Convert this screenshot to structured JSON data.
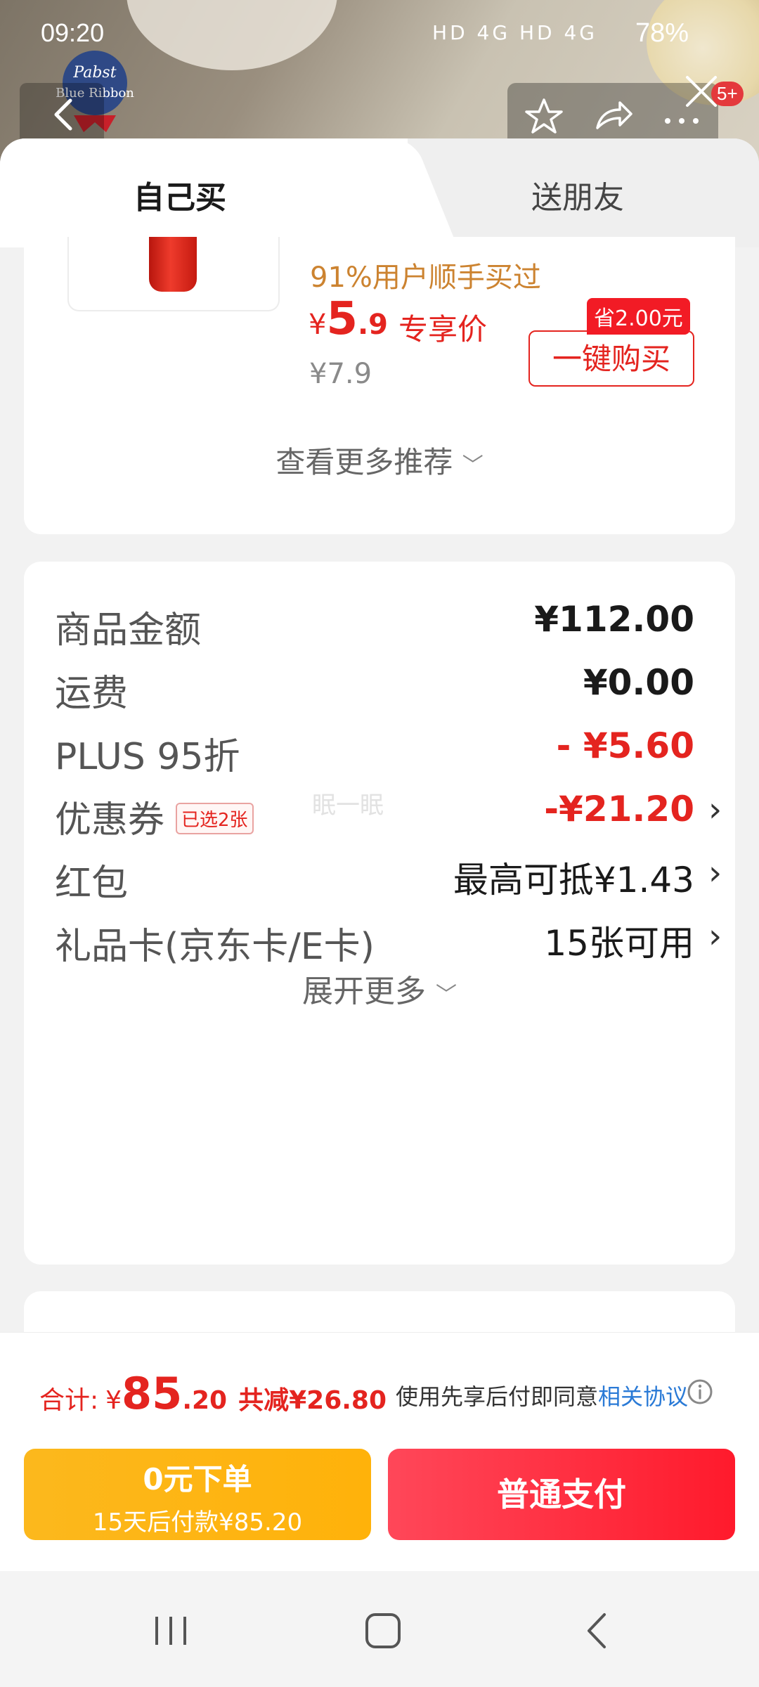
{
  "status_bar": {
    "time": "09:20",
    "battery": "78%",
    "signal": "HD 4G HD 4G"
  },
  "brand": {
    "logo_text": "Pabst Blue Ribbon"
  },
  "top_badge": "5+",
  "tabs": {
    "self": "自己买",
    "friend": "送朋友"
  },
  "recommend": {
    "hot_text": "91%用户顺手买过",
    "price_currency": "¥",
    "price_int": "5",
    "price_dec": ".9",
    "exclusive": "专享价",
    "old_price": "¥7.9",
    "save_tag": "省2.00元",
    "buy_button": "一键购买",
    "more": "查看更多推荐"
  },
  "summary": {
    "rows": [
      {
        "label": "商品金额",
        "value": "¥112.00"
      },
      {
        "label": "运费",
        "value": "¥0.00"
      },
      {
        "label": "PLUS 95折",
        "value": "- ¥5.60"
      },
      {
        "label": "优惠券",
        "tag": "已选2张",
        "value": "-¥21.20"
      },
      {
        "label": "红包",
        "value": "最高可抵¥1.43"
      },
      {
        "label": "礼品卡(京东卡/E卡)",
        "value": "15张可用"
      }
    ],
    "expand": "展开更多",
    "watermark": "眠一眠"
  },
  "bottom": {
    "total_label": "合计:",
    "total_currency": "¥",
    "total_int": "85",
    "total_dec": ".20",
    "total_less": "共减¥26.80",
    "agree_text": "使用先享后付即同意",
    "agree_link": "相关协议",
    "zero_line1": "0元下单",
    "zero_line2": "15天后付款¥85.20",
    "pay_button": "普通支付"
  },
  "colors": {
    "accent": "#e4241f",
    "yellow": "#fcb81d",
    "hot": "#cc8330",
    "link": "#2a7ad6"
  }
}
